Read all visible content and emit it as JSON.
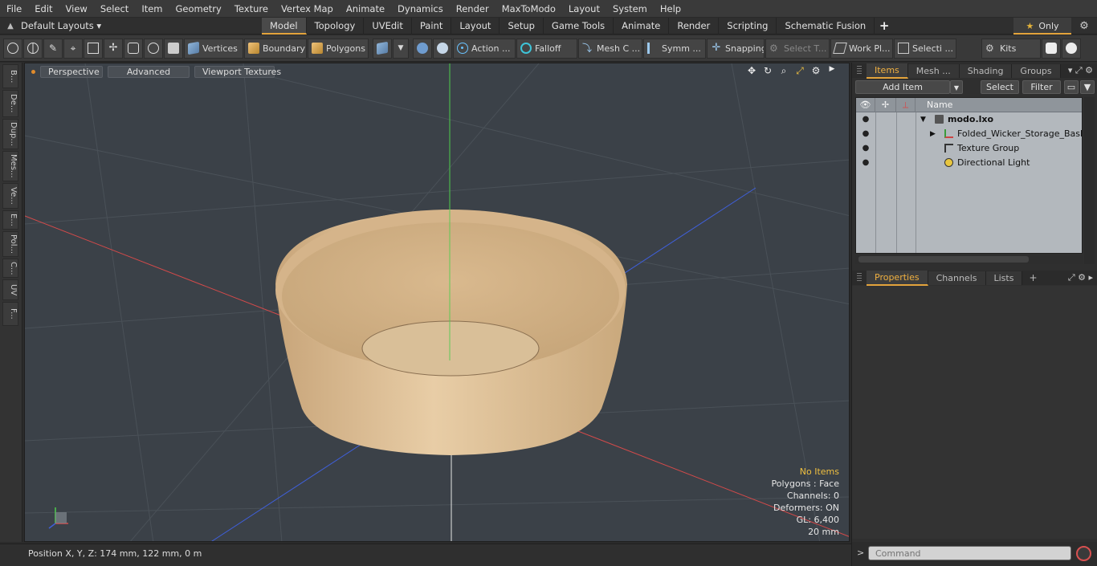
{
  "menu": [
    "File",
    "Edit",
    "View",
    "Select",
    "Item",
    "Geometry",
    "Texture",
    "Vertex Map",
    "Animate",
    "Dynamics",
    "Render",
    "MaxToModo",
    "Layout",
    "System",
    "Help"
  ],
  "layout": {
    "selector": "Default Layouts ▾",
    "tabs": [
      "Model",
      "Topology",
      "UVEdit",
      "Paint",
      "Layout",
      "Setup",
      "Game Tools",
      "Animate",
      "Render",
      "Scripting",
      "Schematic Fusion"
    ],
    "active_tab": "Model",
    "add_tab": "+",
    "only": "Only"
  },
  "toolbar": {
    "vertices": "Vertices",
    "boundary": "Boundary",
    "polygons": "Polygons",
    "action": "Action ...",
    "falloff": "Falloff",
    "mesh": "Mesh C ...",
    "symmetry": "Symm ...",
    "snapping": "Snapping",
    "select_t": "Select T...",
    "work_plane": "Work Pl...",
    "selection": "Selecti ...",
    "kits": "Kits"
  },
  "left_strip": [
    "B...",
    "De...",
    "Dup...",
    "Mes...",
    "Ve...",
    "E...",
    "Pol...",
    "C...",
    "UV",
    "F..."
  ],
  "viewport": {
    "buttons": [
      "Perspective",
      "Advanced",
      "Viewport Textures"
    ],
    "info": {
      "selection": "No Items",
      "polygons": "Polygons : Face",
      "channels": "Channels: 0",
      "deformers": "Deformers: ON",
      "gl": "GL: 6,400",
      "scale": "20 mm"
    },
    "object_color": "#e3c7a0"
  },
  "status": {
    "position": "Position X, Y, Z:   174 mm, 122 mm, 0 m"
  },
  "items_panel": {
    "tabs": [
      "Items",
      "Mesh ...",
      "Shading",
      "Groups"
    ],
    "active_tab": "Items",
    "add_item": "Add Item",
    "select": "Select",
    "filter": "Filter",
    "column_name": "Name",
    "tree": [
      {
        "label": "modo.lxo",
        "kind": "scene-icon"
      },
      {
        "label": "Folded_Wicker_Storage_Basket",
        "kind": "mesh-icon"
      },
      {
        "label": "Texture Group",
        "kind": "texture-group-icon"
      },
      {
        "label": "Directional Light",
        "kind": "light-icon"
      }
    ]
  },
  "props_panel": {
    "tabs": [
      "Properties",
      "Channels",
      "Lists"
    ],
    "active_tab": "Properties",
    "add": "+"
  },
  "command": {
    "prompt": ">",
    "placeholder": "Command"
  },
  "colors": {
    "accent": "#e3a33b",
    "viewport_bg": "#3b4148",
    "axis_x": "#d44a4a",
    "axis_y": "#4ccd4c",
    "axis_z": "#3f5fd8"
  }
}
